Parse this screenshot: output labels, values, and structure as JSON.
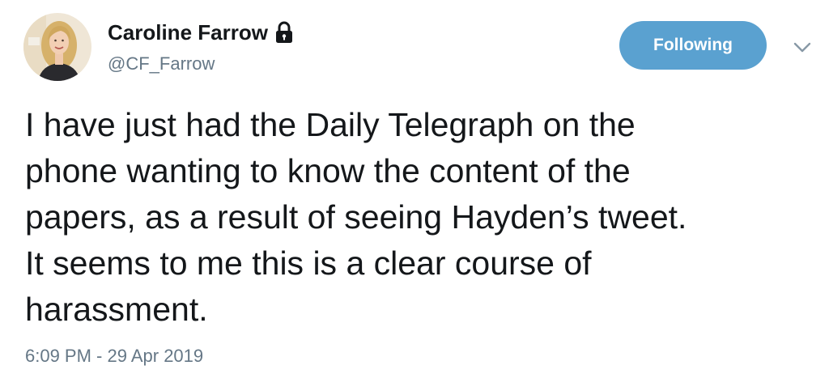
{
  "tweet": {
    "author": {
      "display_name": "Caroline Farrow",
      "handle": "@CF_Farrow",
      "protected_icon": "lock-icon",
      "avatar": "profile-photo"
    },
    "follow_button_label": "Following",
    "menu_icon": "chevron-down-icon",
    "text": "I have just had the Daily Telegraph  on the\nphone wanting to know the content of the\npapers, as a result of seeing Hayden’s tweet.\nIt seems to me this is a clear course of\nharassment.",
    "timestamp": "6:09 PM - 29 Apr 2019"
  },
  "colors": {
    "button_background": "#5aa1d0",
    "primary_text": "#14171a",
    "secondary_text": "#657786"
  }
}
